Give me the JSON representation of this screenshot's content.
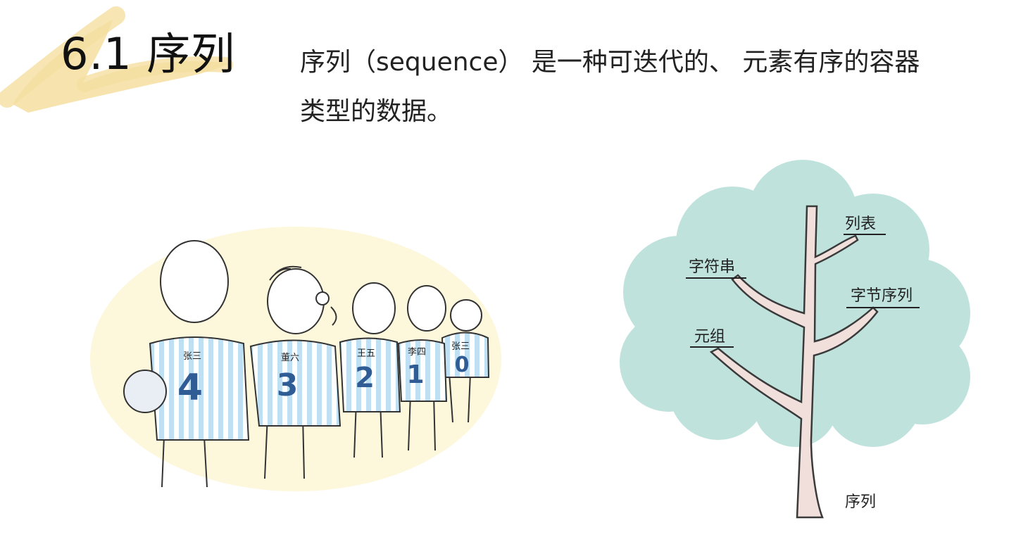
{
  "slide": {
    "title": "6.1 序列",
    "definition": {
      "line1": "序列（sequence） 是一种可迭代的、 元素有序的容器",
      "line2": "类型的数据。"
    }
  },
  "players_illustration": {
    "players": [
      {
        "name": "张三",
        "number": "4"
      },
      {
        "name": "董六",
        "number": "3"
      },
      {
        "name": "王五",
        "number": "2"
      },
      {
        "name": "李四",
        "number": "1"
      },
      {
        "name": "张三",
        "number": "0"
      }
    ]
  },
  "tree_diagram": {
    "root_label": "序列",
    "branches": {
      "list": "列表",
      "string": "字符串",
      "bytes": "字节序列",
      "tuple": "元组"
    }
  },
  "colors": {
    "brush": "#f5dea0",
    "ellipse": "#fdf7dc",
    "jersey_stripe": "#bfe0f2",
    "jersey_number": "#2f5c94",
    "foliage": "#bfe3dc",
    "trunk": "#f1dfdc"
  }
}
